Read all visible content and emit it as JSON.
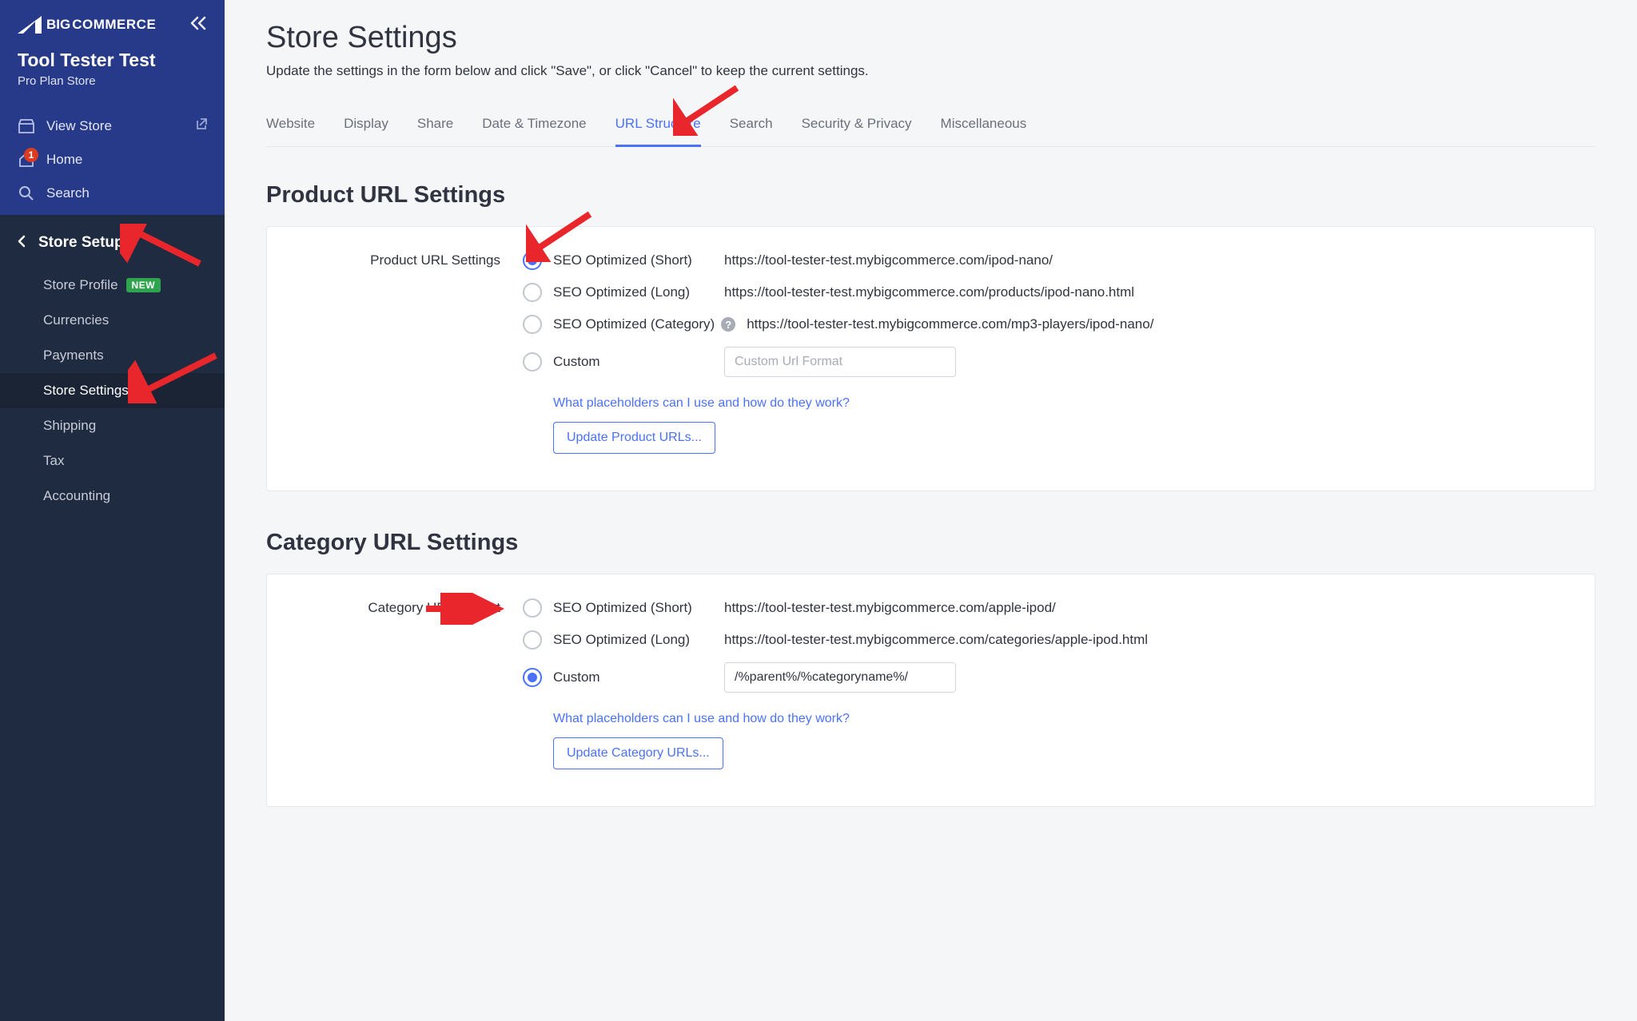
{
  "brand": {
    "part1": "BIG",
    "part2": "COMMERCE"
  },
  "store": {
    "name": "Tool Tester Test",
    "plan": "Pro Plan Store"
  },
  "topnav": {
    "view_store": "View Store",
    "home": "Home",
    "home_badge": "1",
    "search": "Search"
  },
  "sidebar": {
    "section_title": "Store Setup",
    "items": [
      {
        "label": "Store Profile",
        "new": "NEW"
      },
      {
        "label": "Currencies"
      },
      {
        "label": "Payments"
      },
      {
        "label": "Store Settings",
        "active": true
      },
      {
        "label": "Shipping"
      },
      {
        "label": "Tax"
      },
      {
        "label": "Accounting"
      }
    ]
  },
  "page": {
    "title": "Store Settings",
    "desc": "Update the settings in the form below and click \"Save\", or click \"Cancel\" to keep the current settings."
  },
  "tabs": [
    "Website",
    "Display",
    "Share",
    "Date & Timezone",
    "URL Structure",
    "Search",
    "Security & Privacy",
    "Miscellaneous"
  ],
  "active_tab": "URL Structure",
  "product_url": {
    "section_title": "Product URL Settings",
    "row_label": "Product URL Settings",
    "options": [
      {
        "label": "SEO Optimized (Short)",
        "example": "https://tool-tester-test.mybigcommerce.com/ipod-nano/",
        "checked": true
      },
      {
        "label": "SEO Optimized (Long)",
        "example": "https://tool-tester-test.mybigcommerce.com/products/ipod-nano.html"
      },
      {
        "label": "SEO Optimized (Category)",
        "example": "https://tool-tester-test.mybigcommerce.com/mp3-players/ipod-nano/",
        "help": true
      },
      {
        "label": "Custom",
        "input_placeholder": "Custom Url Format",
        "input_value": ""
      }
    ],
    "placeholders_link": "What placeholders can I use and how do they work?",
    "update_btn": "Update Product URLs..."
  },
  "category_url": {
    "section_title": "Category URL Settings",
    "row_label": "Category URL Format",
    "options": [
      {
        "label": "SEO Optimized (Short)",
        "example": "https://tool-tester-test.mybigcommerce.com/apple-ipod/"
      },
      {
        "label": "SEO Optimized (Long)",
        "example": "https://tool-tester-test.mybigcommerce.com/categories/apple-ipod.html"
      },
      {
        "label": "Custom",
        "input_value": "/%parent%/%categoryname%/",
        "checked": true
      }
    ],
    "placeholders_link": "What placeholders can I use and how do they work?",
    "update_btn": "Update Category URLs..."
  }
}
